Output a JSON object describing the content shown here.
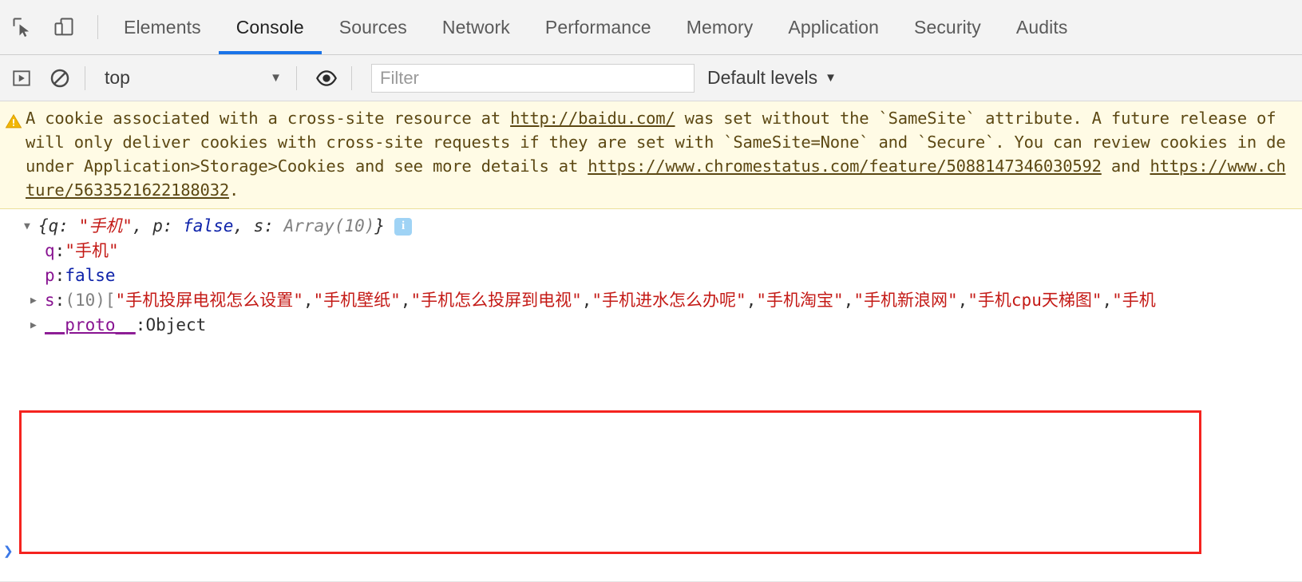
{
  "toolbar": {
    "inspect_icon": "inspect-element-icon",
    "device_icon": "device-toolbar-icon"
  },
  "tabs": [
    {
      "label": "Elements",
      "active": false
    },
    {
      "label": "Console",
      "active": true
    },
    {
      "label": "Sources",
      "active": false
    },
    {
      "label": "Network",
      "active": false
    },
    {
      "label": "Performance",
      "active": false
    },
    {
      "label": "Memory",
      "active": false
    },
    {
      "label": "Application",
      "active": false
    },
    {
      "label": "Security",
      "active": false
    },
    {
      "label": "Audits",
      "active": false
    }
  ],
  "filterbar": {
    "execute_icon": "execute-snippet-icon",
    "clear_icon": "clear-console-icon",
    "context": "top",
    "context_caret": "▼",
    "eye_icon": "live-expression-eye-icon",
    "filter_placeholder": "Filter",
    "levels_label": "Default levels",
    "levels_caret": "▼"
  },
  "warning": {
    "icon": "warning-triangle-icon",
    "line1_pre": "A cookie associated with a cross-site resource at ",
    "link1": "http://baidu.com/",
    "line1_post": " was set without the `SameSite` attribute. A future release of",
    "line2": "will only deliver cookies with cross-site requests if they are set with `SameSite=None` and `Secure`. You can review cookies in de",
    "line3_pre": "under Application>Storage>Cookies and see more details at ",
    "link2": "https://www.chromestatus.com/feature/5088147346030592",
    "line3_mid": " and ",
    "link3": "https://www.ch",
    "line4_link": "ture/5633521622188032",
    "line4_post": "."
  },
  "console_result": {
    "expand_arrow": "▼",
    "collapse_arrow": "▶",
    "preview": {
      "open_brace": "{",
      "key_q": "q",
      "colon": ": ",
      "val_q": "\"手机\"",
      "comma1": ", ",
      "key_p": "p",
      "val_p": "false",
      "comma2": ", ",
      "key_s": "s",
      "val_s": "Array(10)",
      "close_brace": "}",
      "info_icon": "info-badge-icon"
    },
    "props": [
      {
        "name": "q",
        "sep": ": ",
        "value": "\"手机\"",
        "type": "string"
      },
      {
        "name": "p",
        "sep": ": ",
        "value": "false",
        "type": "boolean"
      }
    ],
    "array_row": {
      "name": "s",
      "sep": ": ",
      "count": "(10)",
      "open_bracket": " [",
      "items": [
        "\"手机投屏电视怎么设置\"",
        "\"手机壁纸\"",
        "\"手机怎么投屏到电视\"",
        "\"手机进水怎么办呢\"",
        "\"手机淘宝\"",
        "\"手机新浪网\"",
        "\"手机cpu天梯图\"",
        "\"手机"
      ],
      "separator": ", "
    },
    "proto_row": {
      "name": "__proto__",
      "sep": ": ",
      "value": "Object"
    },
    "prompt_chevron": "❯"
  },
  "colors": {
    "accent": "#1a73e8",
    "annotation_box": "#f5231f",
    "warning_bg": "#fffbe5",
    "string": "#c41a16",
    "property": "#881391",
    "boolean": "#0d22aa",
    "prompt": "#3b78e7"
  }
}
